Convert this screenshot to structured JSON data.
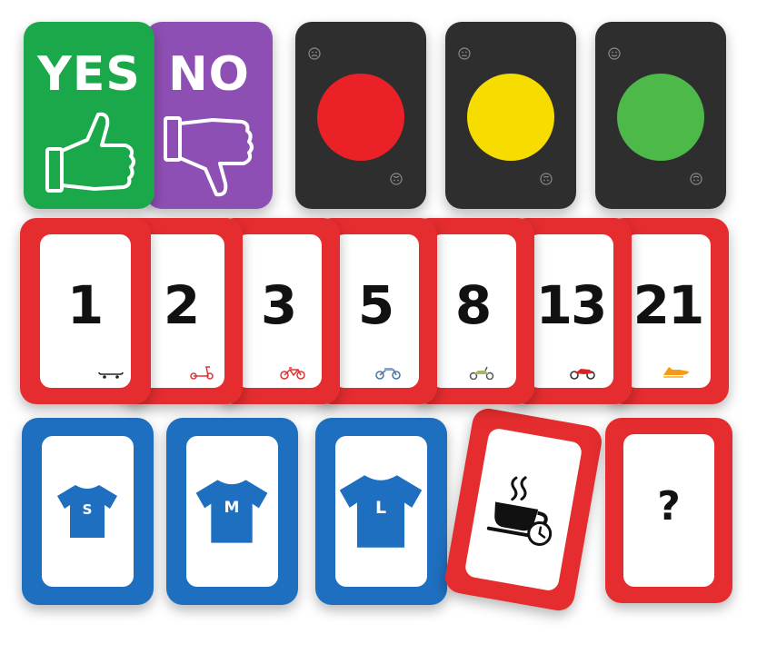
{
  "vote": {
    "yes_label": "YES",
    "no_label": "NO",
    "yes_color": "#1aa84a",
    "no_color": "#8e4fb4"
  },
  "lights": {
    "card_color": "#2e2e2e",
    "red": "#ea2127",
    "yellow": "#f7dc00",
    "green": "#4cb948",
    "icons": [
      "sad-face-icon",
      "neutral-face-icon",
      "happy-face-icon"
    ]
  },
  "estimate": {
    "frame_color": "#e52d2f",
    "cards": [
      {
        "value": "1",
        "icon": "skateboard-icon"
      },
      {
        "value": "2",
        "icon": "scooter-icon"
      },
      {
        "value": "3",
        "icon": "bicycle-icon"
      },
      {
        "value": "5",
        "icon": "motorbike-icon"
      },
      {
        "value": "8",
        "icon": "moped-icon"
      },
      {
        "value": "13",
        "icon": "sportbike-icon"
      },
      {
        "value": "21",
        "icon": "rocket-icon"
      }
    ]
  },
  "sizes": {
    "frame_color": "#1f6fc0",
    "shirt_color": "#1f6fc0",
    "cards": [
      {
        "label": "S"
      },
      {
        "label": "M"
      },
      {
        "label": "L"
      }
    ]
  },
  "specials": {
    "coffee_icon": "coffee-break-icon",
    "question": "?"
  }
}
